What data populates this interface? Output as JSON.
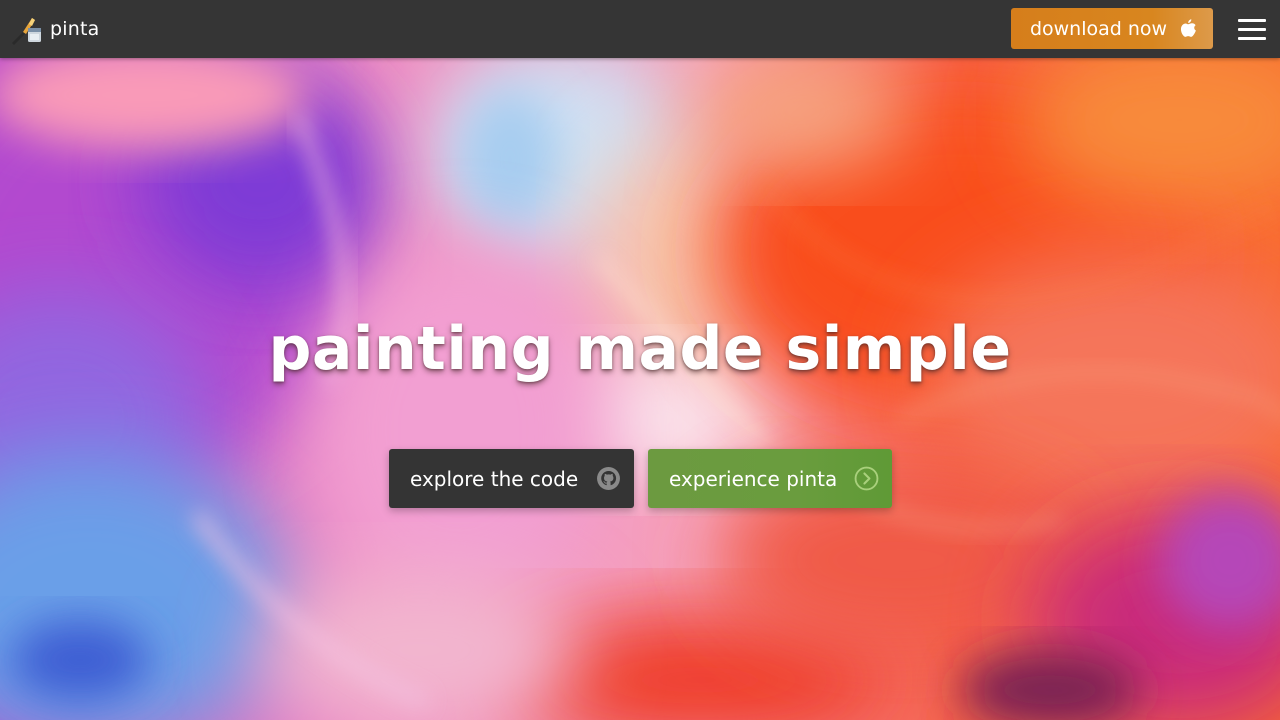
{
  "brand": {
    "name": "pinta",
    "logo_icon": "pinta-paintbrush-logo-icon"
  },
  "nav": {
    "download_label": "download now",
    "download_icon": "apple-icon",
    "menu_icon": "hamburger-menu-icon"
  },
  "hero": {
    "headline": "painting made simple",
    "background": "fluid-paint-artwork"
  },
  "actions": {
    "explore_label": "explore the code",
    "explore_icon": "github-icon",
    "experience_label": "experience pinta",
    "experience_icon": "circle-chevron-right-icon"
  },
  "colors": {
    "navbar": "#353535",
    "download_button": "#d67e1b",
    "explore_button": "#343434",
    "experience_button": "#6a9c3e",
    "text": "#ffffff"
  }
}
